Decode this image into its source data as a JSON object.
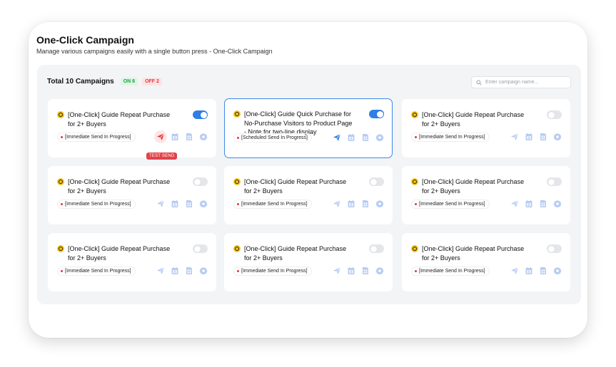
{
  "page": {
    "title": "One-Click Campaign",
    "subtitle": "Manage various campaigns easily with a single button press - One-Click Campaign"
  },
  "summary": {
    "total_label": "Total 10 Campaigns",
    "on_label": "ON 8",
    "off_label": "OFF 2"
  },
  "search": {
    "placeholder": "Enter campaign name..."
  },
  "colors": {
    "accent": "#2f7fe6",
    "icon_muted": "#b7ccf2",
    "on_badge": "#22a04b",
    "off_badge": "#e0383e",
    "coin": "#f5c518"
  },
  "icons": [
    "paper-plane-icon",
    "calendar-icon",
    "document-icon",
    "gear-icon",
    "search-icon",
    "coin-icon"
  ],
  "tooltip": {
    "label": "TEST SEND"
  },
  "campaigns": [
    {
      "title": "[One-Click] Guide Repeat Purchase for 2+ Buyers",
      "status": "[Immediate Send In Progress]",
      "enabled": true
    },
    {
      "title": "[One-Click] Guide Quick Purchase for No-Purchase Visitors to Product Page - Note for two-line display",
      "status": "[Scheduled Send In Progress]",
      "enabled": true
    },
    {
      "title": "[One-Click] Guide Repeat Purchase for 2+ Buyers",
      "status": "[Immediate Send In Progress]",
      "enabled": false
    },
    {
      "title": "[One-Click] Guide Repeat Purchase for 2+ Buyers",
      "status": "[Immediate Send In Progress]",
      "enabled": false
    },
    {
      "title": "[One-Click] Guide Repeat Purchase for 2+ Buyers",
      "status": "[Immediate Send In Progress]",
      "enabled": false
    },
    {
      "title": "[One-Click] Guide Repeat Purchase for 2+ Buyers",
      "status": "[Immediate Send In Progress]",
      "enabled": false
    },
    {
      "title": "[One-Click] Guide Repeat Purchase for 2+ Buyers",
      "status": "[Immediate Send In Progress]",
      "enabled": false
    },
    {
      "title": "[One-Click] Guide Repeat Purchase for 2+ Buyers",
      "status": "[Immediate Send In Progress]",
      "enabled": false
    },
    {
      "title": "[One-Click] Guide Repeat Purchase for 2+ Buyers",
      "status": "[Immediate Send In Progress]",
      "enabled": false
    }
  ]
}
